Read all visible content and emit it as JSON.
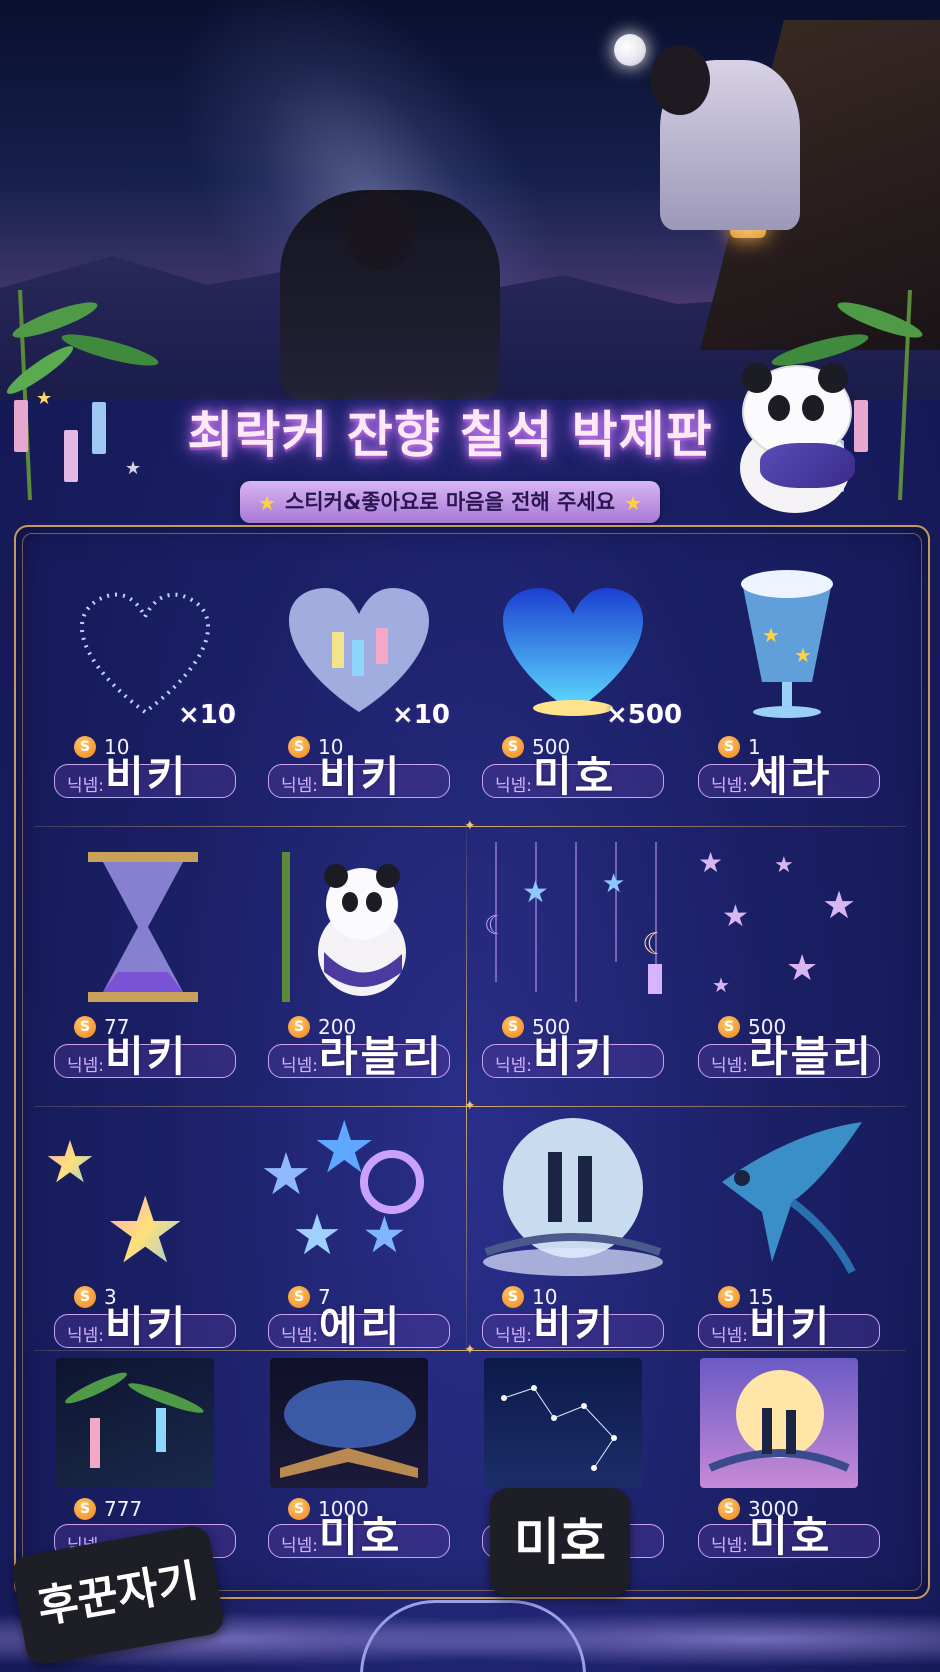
{
  "title": "최락커 잔향 칠석 박제판",
  "subtitle": "스티커&좋아요로 마음을 전해 주세요",
  "coin_symbol": "S",
  "nick_label": "닉넴:",
  "colors": {
    "accent": "#d48cff",
    "coin": "#f0861a",
    "frame": "#c59a5a",
    "background": "#1b2066"
  },
  "items": [
    {
      "icon": "star-heart-outline-icon",
      "multiplier": "×10",
      "price": "10",
      "nickname": "비키"
    },
    {
      "icon": "tanabata-heart-icon",
      "multiplier": "×10",
      "price": "10",
      "nickname": "비키"
    },
    {
      "icon": "galaxy-heart-lantern-icon",
      "multiplier": "×500",
      "price": "500",
      "nickname": "미호"
    },
    {
      "icon": "star-parfait-drink-icon",
      "multiplier": "",
      "price": "1",
      "nickname": "세라"
    },
    {
      "icon": "hourglass-icon",
      "multiplier": "",
      "price": "77",
      "nickname": "비키"
    },
    {
      "icon": "panda-bamboo-icon",
      "multiplier": "",
      "price": "200",
      "nickname": "라블리"
    },
    {
      "icon": "moon-star-mobile-icon",
      "multiplier": "",
      "price": "500",
      "nickname": "비키"
    },
    {
      "icon": "sparkle-stars-icon",
      "multiplier": "",
      "price": "500",
      "nickname": "라블리"
    },
    {
      "icon": "rainbow-stars-icon",
      "multiplier": "",
      "price": "3",
      "nickname": "비키"
    },
    {
      "icon": "star-balloons-icon",
      "multiplier": "",
      "price": "7",
      "nickname": "에리"
    },
    {
      "icon": "moon-lovers-bridge-icon",
      "multiplier": "",
      "price": "10",
      "nickname": "비키"
    },
    {
      "icon": "magpie-bird-icon",
      "multiplier": "",
      "price": "15",
      "nickname": "비키"
    },
    {
      "icon": "tanabata-bamboo-photo-icon",
      "multiplier": "",
      "price": "777",
      "nickname": ""
    },
    {
      "icon": "magic-book-photo-icon",
      "multiplier": "",
      "price": "1000",
      "nickname": "미호"
    },
    {
      "icon": "constellation-photo-icon",
      "multiplier": "",
      "price": "",
      "nickname": ""
    },
    {
      "icon": "moon-couple-photo-icon",
      "multiplier": "",
      "price": "3000",
      "nickname": "미호"
    }
  ],
  "stamps": {
    "left": "후꾼자기",
    "center": "미호"
  }
}
